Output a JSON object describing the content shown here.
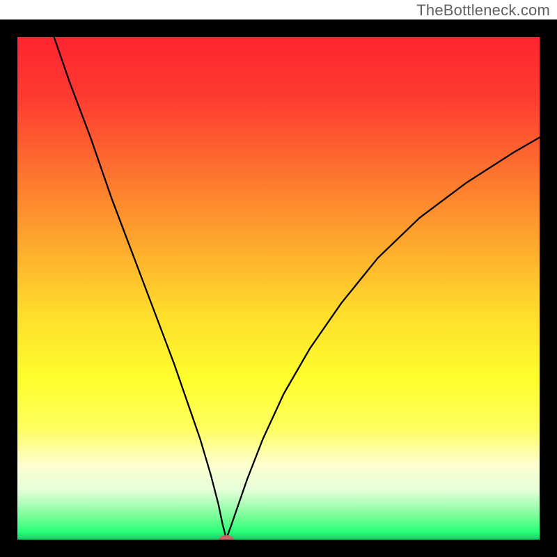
{
  "watermark": {
    "text": "TheBottleneck.com"
  },
  "chart_data": {
    "type": "line",
    "title": "",
    "xlabel": "",
    "ylabel": "",
    "xlim": [
      0,
      100
    ],
    "ylim": [
      0,
      100
    ],
    "grid": false,
    "legend": false,
    "series": [
      {
        "name": "curve",
        "color": "#000000",
        "x": [
          7,
          10,
          14,
          18,
          22,
          26,
          30,
          33,
          35,
          37,
          38.5,
          39.3,
          39.8,
          40,
          40.3,
          41,
          42,
          44,
          47,
          51,
          56,
          62,
          69,
          77,
          86,
          95,
          100
        ],
        "y": [
          100,
          91,
          80,
          68,
          57,
          46,
          35,
          26,
          20,
          13,
          7,
          3,
          1,
          0,
          1,
          3,
          6,
          12,
          20,
          29,
          38,
          47,
          56,
          64,
          71,
          77,
          80
        ]
      }
    ],
    "marker": {
      "x": 40,
      "y": 0,
      "rx": 1.4,
      "ry": 0.9,
      "color": "#cc6666"
    },
    "gradient_stops": [
      {
        "offset": 0.0,
        "color": "#fe2430"
      },
      {
        "offset": 0.12,
        "color": "#fe3b30"
      },
      {
        "offset": 0.25,
        "color": "#fd6b2f"
      },
      {
        "offset": 0.4,
        "color": "#fea42d"
      },
      {
        "offset": 0.55,
        "color": "#fedd2c"
      },
      {
        "offset": 0.68,
        "color": "#fefe2c"
      },
      {
        "offset": 0.78,
        "color": "#fefe60"
      },
      {
        "offset": 0.85,
        "color": "#fefecf"
      },
      {
        "offset": 0.9,
        "color": "#e7feda"
      },
      {
        "offset": 0.93,
        "color": "#acfeb8"
      },
      {
        "offset": 0.96,
        "color": "#68fd8f"
      },
      {
        "offset": 0.985,
        "color": "#29fe79"
      },
      {
        "offset": 1.0,
        "color": "#13cc68"
      }
    ]
  }
}
